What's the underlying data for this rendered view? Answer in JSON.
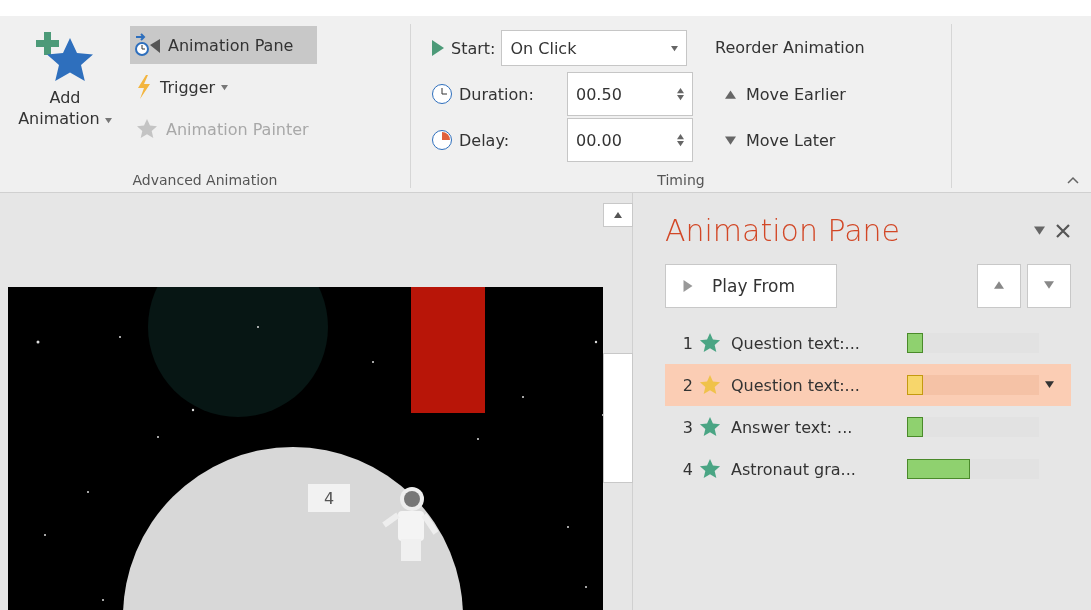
{
  "ribbon": {
    "advanced_animation": {
      "add_animation": [
        "Add",
        "Animation"
      ],
      "animation_pane": {
        "label": "Animation Pane",
        "selected": true
      },
      "trigger": {
        "label": "Trigger"
      },
      "animation_painter": {
        "label": "Animation Painter",
        "disabled": true
      },
      "group_label": "Advanced Animation"
    },
    "timing": {
      "start": {
        "label": "Start:",
        "value": "On Click"
      },
      "duration": {
        "label": "Duration:",
        "value": "00.50"
      },
      "delay": {
        "label": "Delay:",
        "value": "00.00"
      },
      "reorder_title": "Reorder Animation",
      "move_earlier": "Move Earlier",
      "move_later": "Move Later",
      "group_label": "Timing"
    }
  },
  "slide": {
    "tag": "4"
  },
  "animation_pane": {
    "title": "Animation Pane",
    "play_button": "Play From",
    "items": [
      {
        "number": "1",
        "label": "Question text:...",
        "color": "#8fd16f",
        "level": 0.12,
        "selected": false
      },
      {
        "number": "2",
        "label": "Question text:...",
        "color": "#f7d66b",
        "level": 0.12,
        "selected": true
      },
      {
        "number": "3",
        "label": "Answer text: ...",
        "color": "#8fd16f",
        "level": 0.12,
        "selected": false
      },
      {
        "number": "4",
        "label": "Astronaut gra...",
        "color": "#8fd16f",
        "level": 0.48,
        "selected": false
      }
    ]
  }
}
